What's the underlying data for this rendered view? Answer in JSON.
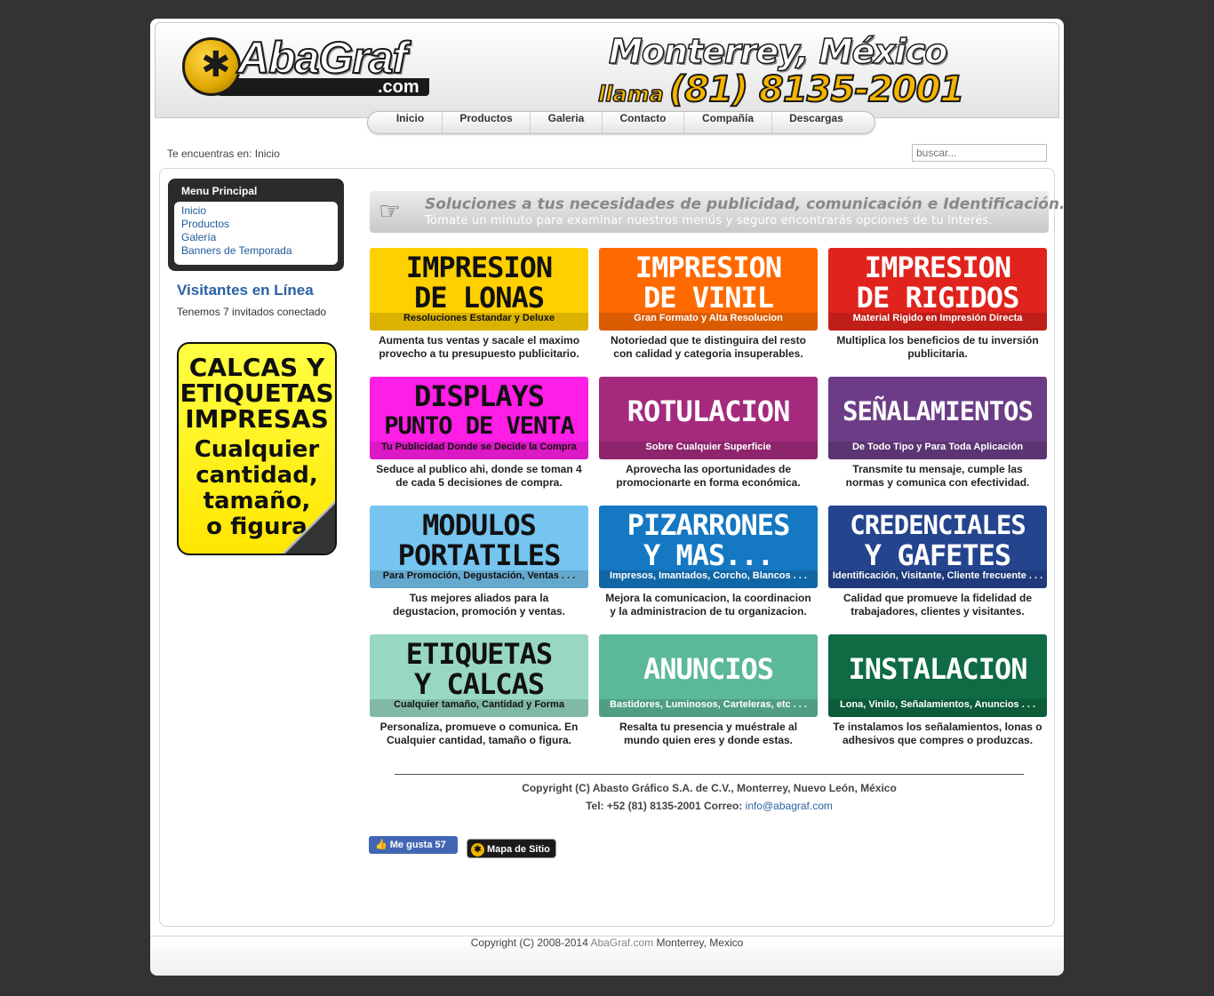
{
  "header": {
    "logo_text": "AbaGraf",
    "logo_suffix": ".com",
    "city": "Monterrey, México",
    "phone_label": "llama",
    "phone_number": "(81) 8135-2001"
  },
  "nav": [
    "Inicio",
    "Productos",
    "Galeria",
    "Contacto",
    "Compañía",
    "Descargas"
  ],
  "breadcrumb": "Te encuentras en: Inicio",
  "search": {
    "placeholder": "buscar..."
  },
  "menu": {
    "title": "Menu Principal",
    "items": [
      "Inicio",
      "Productos",
      "Galería",
      "Banners de Temporada"
    ]
  },
  "visitors": {
    "title": "Visitantes en Línea",
    "text": "Tenemos 7 invitados conectado"
  },
  "promo": {
    "line1a": "CALCAS Y",
    "line1b": "ETIQUETAS",
    "line1c": "IMPRESAS",
    "line2a": "Cualquier",
    "line2b": "cantidad,",
    "line2c": "tamaño,",
    "line2d": "o figura"
  },
  "tagline": {
    "line1": "Soluciones a tus necesidades de publicidad, comunicación e Identificación.",
    "line2": "Tómate un minuto para examinar nuestros menús y seguro encontrarás opciones de tu interés."
  },
  "cards": [
    {
      "t1": "IMPRESION",
      "t2": "DE LONAS",
      "sub": "Resoluciones Estandar y Deluxe",
      "d1": "Aumenta tus ventas y sacale el maximo",
      "d2": "provecho a tu presupuesto publicitario.",
      "bg": "#ffd000",
      "fg": "#111111"
    },
    {
      "t1": "IMPRESION",
      "t2": "DE VINIL",
      "sub": "Gran Formato y Alta Resolucion",
      "d1": "Notoriedad que te distinguira del resto",
      "d2": "con calidad y categoria insuperables.",
      "bg": "#ff6a00",
      "fg": "#ffffff"
    },
    {
      "t1": "IMPRESION",
      "t2": "DE RIGIDOS",
      "sub": "Material Rigido en Impresión Directa",
      "d1": "Multiplica los beneficios de tu inversión",
      "d2": "publicitaria.",
      "bg": "#e0231c",
      "fg": "#ffffff"
    },
    {
      "t1": "DISPLAYS",
      "t2": "PUNTO DE VENTA",
      "sub": "Tu Publicidad Donde se Decide la Compra",
      "d1": "Seduce al publico ahi, donde se toman 4",
      "d2": "de cada 5 decisiones de compra.",
      "bg": "#ff1ee6",
      "fg": "#111111"
    },
    {
      "t1": "ROTULACION",
      "t2": "",
      "sub": "Sobre Cualquier Superficie",
      "d1": "Aprovecha las oportunidades de",
      "d2": "promocionarte en forma económica.",
      "bg": "#a52a7e",
      "fg": "#ffffff"
    },
    {
      "t1": "SEÑALAMIENTOS",
      "t2": "",
      "sub": "De Todo Tipo y Para Toda Aplicación",
      "d1": "Transmite tu mensaje, cumple las",
      "d2": "normas y comunica con efectividad.",
      "bg": "#6c3d86",
      "fg": "#ffffff"
    },
    {
      "t1": "MODULOS",
      "t2": "PORTATILES",
      "sub": "Para Promoción, Degustación, Ventas . . .",
      "d1": "Tus mejores aliados para la",
      "d2": "degustacion, promoción y ventas.",
      "bg": "#76c4f0",
      "fg": "#111111"
    },
    {
      "t1": "PIZARRONES",
      "t2": "Y MAS...",
      "sub": "Impresos, Imantados, Corcho, Blancos . . .",
      "d1": "Mejora la comunicacion, la coordinacion",
      "d2": "y la administracion de tu organizacion.",
      "bg": "#1478c2",
      "fg": "#ffffff"
    },
    {
      "t1": "CREDENCIALES",
      "t2": "Y GAFETES",
      "sub": "Identificación, Visitante, Cliente frecuente . . .",
      "d1": "Calidad que promueve la fidelidad de",
      "d2": "trabajadores, clientes y visitantes.",
      "bg": "#24448e",
      "fg": "#ffffff"
    },
    {
      "t1": "ETIQUETAS",
      "t2": "Y CALCAS",
      "sub": "Cualquier tamaño, Cantidad y Forma",
      "d1": "Personaliza, promueve o comunica. En",
      "d2": "Cualquier cantidad, tamaño o figura.",
      "bg": "#98d8c0",
      "fg": "#111111"
    },
    {
      "t1": "ANUNCIOS",
      "t2": "",
      "sub": "Bastidores, Luminosos, Carteleras, etc . . .",
      "d1": "Resalta tu presencia y muéstrale al",
      "d2": "mundo quien eres y donde estas.",
      "bg": "#5cb89a",
      "fg": "#ffffff"
    },
    {
      "t1": "INSTALACION",
      "t2": "",
      "sub": "Lona, Vinilo, Señalamientos, Anuncios . . .",
      "d1": "Te instalamos los señalamientos, lonas o",
      "d2": "adhesivos que compres o produzcas.",
      "bg": "#0e6b43",
      "fg": "#ffffff"
    }
  ],
  "footer": {
    "copyright": "Copyright (C) Abasto Gráfico S.A. de C.V., Monterrey, Nuevo León, México",
    "contact": "Tel: +52 (81) 8135-2001 Correo:",
    "email": "info@abagraf.com",
    "like_label": "Me gusta",
    "like_count": "57",
    "sitemap": "Mapa de Sitio"
  },
  "bottom": {
    "prefix": "Copyright (C) 2008-2014",
    "site": "AbaGraf.com",
    "suffix": "Monterrey, Mexico"
  }
}
